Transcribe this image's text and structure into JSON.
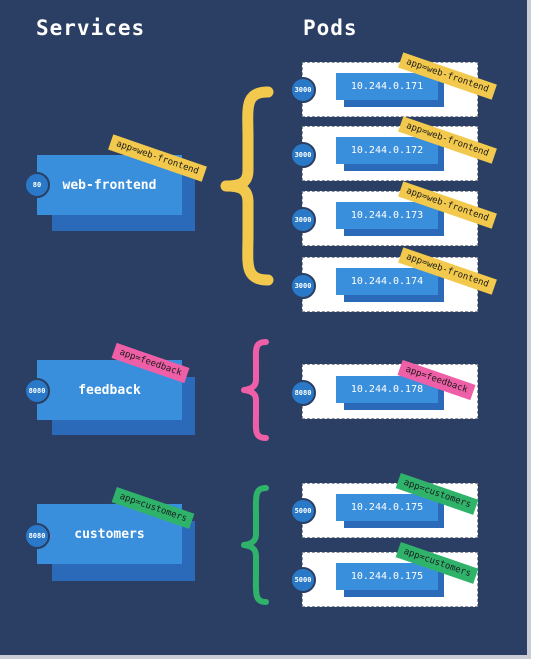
{
  "headings": {
    "services": "Services",
    "pods": "Pods"
  },
  "colors": {
    "yellow": "#f2c94c",
    "pink": "#ef5fa7",
    "green": "#2fb36b",
    "background": "#2a3f63"
  },
  "services": [
    {
      "name": "web-frontend",
      "port": "80",
      "label": "app=web-frontend",
      "color": "yellow"
    },
    {
      "name": "feedback",
      "port": "8080",
      "label": "app=feedback",
      "color": "pink"
    },
    {
      "name": "customers",
      "port": "8080",
      "label": "app=customers",
      "color": "green"
    }
  ],
  "pods": [
    {
      "ip": "10.244.0.171",
      "port": "3000",
      "label": "app=web-frontend",
      "color": "yellow"
    },
    {
      "ip": "10.244.0.172",
      "port": "3000",
      "label": "app=web-frontend",
      "color": "yellow"
    },
    {
      "ip": "10.244.0.173",
      "port": "3000",
      "label": "app=web-frontend",
      "color": "yellow"
    },
    {
      "ip": "10.244.0.174",
      "port": "3000",
      "label": "app=web-frontend",
      "color": "yellow"
    },
    {
      "ip": "10.244.0.178",
      "port": "8080",
      "label": "app=feedback",
      "color": "pink"
    },
    {
      "ip": "10.244.0.175",
      "port": "5000",
      "label": "app=customers",
      "color": "green"
    },
    {
      "ip": "10.244.0.175",
      "port": "5000",
      "label": "app=customers",
      "color": "green"
    }
  ]
}
